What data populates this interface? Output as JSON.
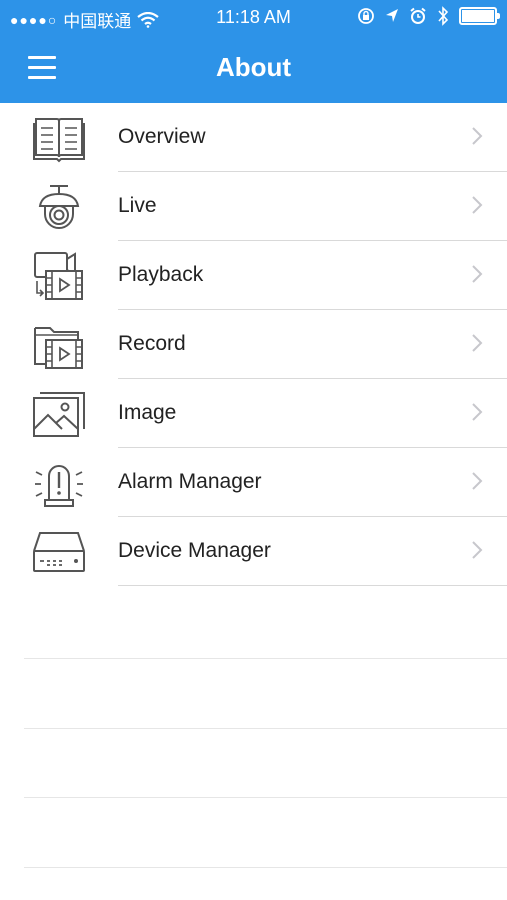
{
  "status_bar": {
    "signal_dots": "●●●●○",
    "carrier": "中国联通",
    "wifi_icon": "wifi-icon",
    "time": "11:18 AM",
    "icons": [
      "rotation-lock-icon",
      "location-icon",
      "alarm-icon",
      "bluetooth-icon",
      "battery-icon"
    ]
  },
  "header": {
    "title": "About",
    "background": "#2d93e8",
    "menu_icon": "hamburger-menu-icon"
  },
  "menu": {
    "items": [
      {
        "label": "Overview",
        "icon": "book-icon"
      },
      {
        "label": "Live",
        "icon": "camera-icon"
      },
      {
        "label": "Playback",
        "icon": "playback-icon"
      },
      {
        "label": "Record",
        "icon": "record-folder-icon"
      },
      {
        "label": "Image",
        "icon": "image-icon"
      },
      {
        "label": "Alarm Manager",
        "icon": "alarm-light-icon"
      },
      {
        "label": "Device Manager",
        "icon": "nvr-device-icon"
      }
    ]
  }
}
